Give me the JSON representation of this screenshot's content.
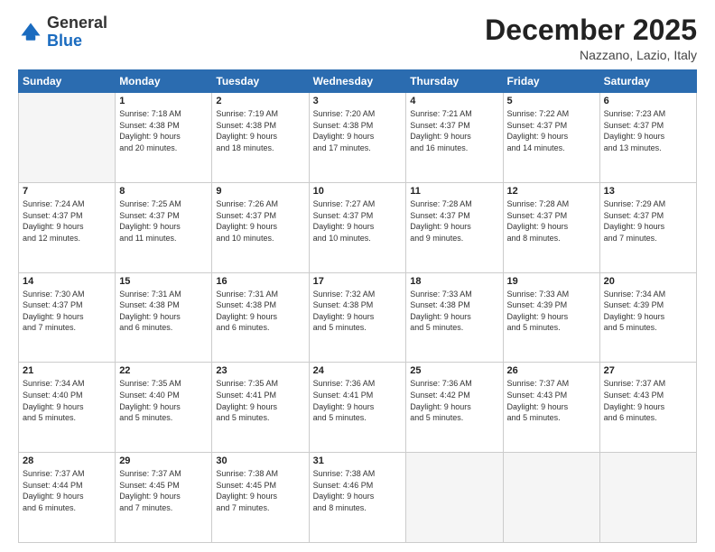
{
  "header": {
    "logo_general": "General",
    "logo_blue": "Blue",
    "month_title": "December 2025",
    "location": "Nazzano, Lazio, Italy"
  },
  "days_of_week": [
    "Sunday",
    "Monday",
    "Tuesday",
    "Wednesday",
    "Thursday",
    "Friday",
    "Saturday"
  ],
  "weeks": [
    [
      {
        "day": "",
        "info": ""
      },
      {
        "day": "1",
        "info": "Sunrise: 7:18 AM\nSunset: 4:38 PM\nDaylight: 9 hours\nand 20 minutes."
      },
      {
        "day": "2",
        "info": "Sunrise: 7:19 AM\nSunset: 4:38 PM\nDaylight: 9 hours\nand 18 minutes."
      },
      {
        "day": "3",
        "info": "Sunrise: 7:20 AM\nSunset: 4:38 PM\nDaylight: 9 hours\nand 17 minutes."
      },
      {
        "day": "4",
        "info": "Sunrise: 7:21 AM\nSunset: 4:37 PM\nDaylight: 9 hours\nand 16 minutes."
      },
      {
        "day": "5",
        "info": "Sunrise: 7:22 AM\nSunset: 4:37 PM\nDaylight: 9 hours\nand 14 minutes."
      },
      {
        "day": "6",
        "info": "Sunrise: 7:23 AM\nSunset: 4:37 PM\nDaylight: 9 hours\nand 13 minutes."
      }
    ],
    [
      {
        "day": "7",
        "info": "Sunrise: 7:24 AM\nSunset: 4:37 PM\nDaylight: 9 hours\nand 12 minutes."
      },
      {
        "day": "8",
        "info": "Sunrise: 7:25 AM\nSunset: 4:37 PM\nDaylight: 9 hours\nand 11 minutes."
      },
      {
        "day": "9",
        "info": "Sunrise: 7:26 AM\nSunset: 4:37 PM\nDaylight: 9 hours\nand 10 minutes."
      },
      {
        "day": "10",
        "info": "Sunrise: 7:27 AM\nSunset: 4:37 PM\nDaylight: 9 hours\nand 10 minutes."
      },
      {
        "day": "11",
        "info": "Sunrise: 7:28 AM\nSunset: 4:37 PM\nDaylight: 9 hours\nand 9 minutes."
      },
      {
        "day": "12",
        "info": "Sunrise: 7:28 AM\nSunset: 4:37 PM\nDaylight: 9 hours\nand 8 minutes."
      },
      {
        "day": "13",
        "info": "Sunrise: 7:29 AM\nSunset: 4:37 PM\nDaylight: 9 hours\nand 7 minutes."
      }
    ],
    [
      {
        "day": "14",
        "info": "Sunrise: 7:30 AM\nSunset: 4:37 PM\nDaylight: 9 hours\nand 7 minutes."
      },
      {
        "day": "15",
        "info": "Sunrise: 7:31 AM\nSunset: 4:38 PM\nDaylight: 9 hours\nand 6 minutes."
      },
      {
        "day": "16",
        "info": "Sunrise: 7:31 AM\nSunset: 4:38 PM\nDaylight: 9 hours\nand 6 minutes."
      },
      {
        "day": "17",
        "info": "Sunrise: 7:32 AM\nSunset: 4:38 PM\nDaylight: 9 hours\nand 5 minutes."
      },
      {
        "day": "18",
        "info": "Sunrise: 7:33 AM\nSunset: 4:38 PM\nDaylight: 9 hours\nand 5 minutes."
      },
      {
        "day": "19",
        "info": "Sunrise: 7:33 AM\nSunset: 4:39 PM\nDaylight: 9 hours\nand 5 minutes."
      },
      {
        "day": "20",
        "info": "Sunrise: 7:34 AM\nSunset: 4:39 PM\nDaylight: 9 hours\nand 5 minutes."
      }
    ],
    [
      {
        "day": "21",
        "info": "Sunrise: 7:34 AM\nSunset: 4:40 PM\nDaylight: 9 hours\nand 5 minutes."
      },
      {
        "day": "22",
        "info": "Sunrise: 7:35 AM\nSunset: 4:40 PM\nDaylight: 9 hours\nand 5 minutes."
      },
      {
        "day": "23",
        "info": "Sunrise: 7:35 AM\nSunset: 4:41 PM\nDaylight: 9 hours\nand 5 minutes."
      },
      {
        "day": "24",
        "info": "Sunrise: 7:36 AM\nSunset: 4:41 PM\nDaylight: 9 hours\nand 5 minutes."
      },
      {
        "day": "25",
        "info": "Sunrise: 7:36 AM\nSunset: 4:42 PM\nDaylight: 9 hours\nand 5 minutes."
      },
      {
        "day": "26",
        "info": "Sunrise: 7:37 AM\nSunset: 4:43 PM\nDaylight: 9 hours\nand 5 minutes."
      },
      {
        "day": "27",
        "info": "Sunrise: 7:37 AM\nSunset: 4:43 PM\nDaylight: 9 hours\nand 6 minutes."
      }
    ],
    [
      {
        "day": "28",
        "info": "Sunrise: 7:37 AM\nSunset: 4:44 PM\nDaylight: 9 hours\nand 6 minutes."
      },
      {
        "day": "29",
        "info": "Sunrise: 7:37 AM\nSunset: 4:45 PM\nDaylight: 9 hours\nand 7 minutes."
      },
      {
        "day": "30",
        "info": "Sunrise: 7:38 AM\nSunset: 4:45 PM\nDaylight: 9 hours\nand 7 minutes."
      },
      {
        "day": "31",
        "info": "Sunrise: 7:38 AM\nSunset: 4:46 PM\nDaylight: 9 hours\nand 8 minutes."
      },
      {
        "day": "",
        "info": ""
      },
      {
        "day": "",
        "info": ""
      },
      {
        "day": "",
        "info": ""
      }
    ]
  ]
}
